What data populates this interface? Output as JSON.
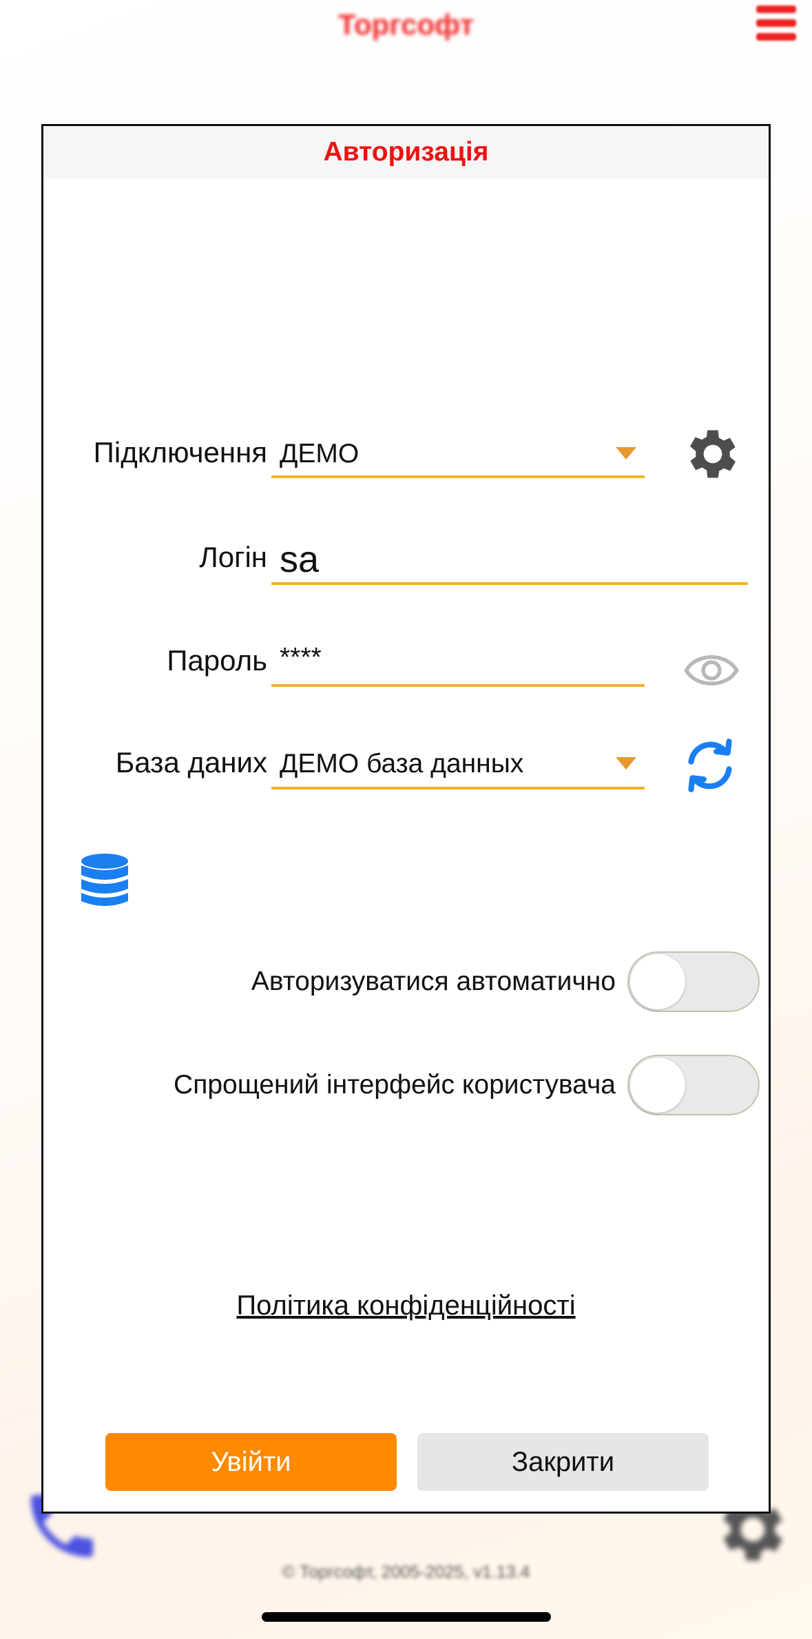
{
  "background": {
    "app_title": "Торгсофт",
    "copyright": "© Торгсофт, 2005-2025, v1.13.4"
  },
  "dialog": {
    "title": "Авторизація",
    "connection": {
      "label": "Підключення",
      "value": "ДЕМО"
    },
    "login": {
      "label": "Логін",
      "value": "sa"
    },
    "password": {
      "label": "Пароль",
      "value": "****"
    },
    "database": {
      "label": "База даних",
      "value": "ДЕМО база данных"
    },
    "auto_login": {
      "label": "Авторизуватися автоматично",
      "enabled": false
    },
    "simple_ui": {
      "label": "Спрощений інтерфейс користувача",
      "enabled": false
    },
    "privacy_link": "Політика конфіденційності",
    "login_button": "Увійти",
    "close_button": "Закрити"
  },
  "colors": {
    "accent": "#ff8a00",
    "underline": "#f2b02a",
    "title_red": "#ee1111",
    "icon_blue": "#1a7ff0"
  },
  "icons": {
    "connection_settings": "gear-icon",
    "password_toggle": "eye-icon",
    "database_refresh": "refresh-icon",
    "database": "database-icon",
    "menu": "hamburger-menu-icon",
    "call": "phone-icon",
    "settings": "gear-icon"
  }
}
